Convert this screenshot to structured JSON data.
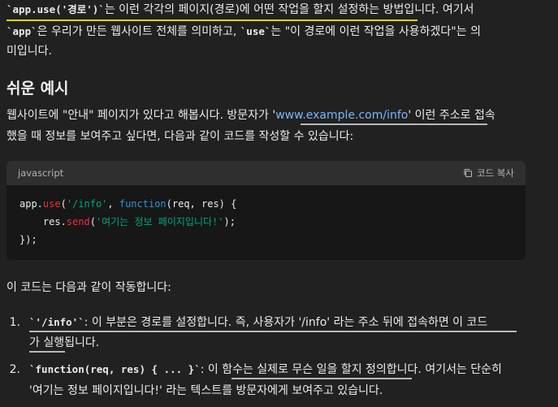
{
  "intro": {
    "line1_code": "`app.use('경로')`",
    "line1_text": "는 이런 각각의 페이지(경로)에 어떤 작업을 할지 설정하는 방법입니다. 여기서",
    "line2_code1": "`app`",
    "line2_text1": "은 우리가 만든 웹사이트 전체를 의미하고,",
    "line2_code2": "`use`",
    "line2_text2": "는 \"이 경로에 이런 작업을 사용하겠다\"는 의",
    "line3_text": "미입니다."
  },
  "section": {
    "heading": "쉬운 예시"
  },
  "para": {
    "line1_a": "웹사이트에 \"안내\" 페이지가 있다고 해봅시다. 방문자가 '",
    "line1_link": "www.example.com/info",
    "line1_b": "' 이런 주소로 접속",
    "line2": "했을 때 정보를 보여주고 싶다면, 다음과 같이 코드를 작성할 수 있습니다:"
  },
  "code_block": {
    "language": "javascript",
    "copy_label": "코드 복사",
    "l1_a": "app.",
    "l1_fn": "use",
    "l1_b": "(",
    "l1_str": "'/info'",
    "l1_c": ", ",
    "l1_kw": "function",
    "l1_d": "(req, res) {",
    "l2_indent": "    res.",
    "l2_fn": "send",
    "l2_a": "(",
    "l2_str": "'여기는 정보 페이지입니다!'",
    "l2_b": ");",
    "l3": "});"
  },
  "after": {
    "text": "이 코드는 다음과 같이 작동합니다:"
  },
  "list": [
    {
      "num": "1.",
      "code": "`'/info'`",
      "text_a": ": 이 부분은 경로를 설정합니다. 즉, 사용자가 '/info' 라는 주소 뒤에 접속하면 이 코드",
      "text_b": "가 실행됩니다."
    },
    {
      "num": "2.",
      "code": "`function(req, res) { ... }`",
      "text_a": ": 이 함수는 실제로 무슨 일을 할지 정의합니다. 여기서는 단순히",
      "text_b": "'여기는 정보 페이지입니다!' 라는 텍스트를 방문자에게 보여주고 있습니다."
    }
  ]
}
